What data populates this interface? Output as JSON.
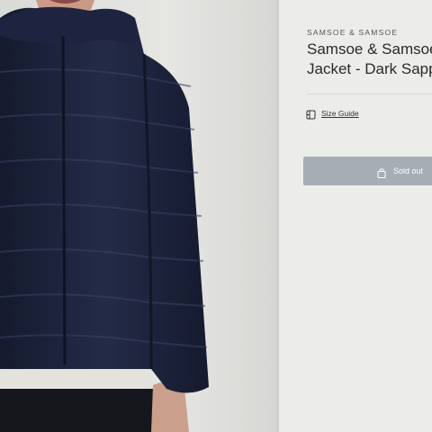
{
  "product": {
    "brand": "SAMSOE & SAMSOE",
    "title_line1": "Samsoe & Samsoe",
    "title_line2": "Jacket - Dark Sapph"
  },
  "size_guide": {
    "label": "Size Guide",
    "icon": "size-chart-icon"
  },
  "cart_button": {
    "label": "Sold out",
    "icon": "shopping-bag-icon",
    "color": "#a7adb5"
  },
  "colors": {
    "jacket": "#1b2138",
    "background": "#e9e9e7"
  }
}
